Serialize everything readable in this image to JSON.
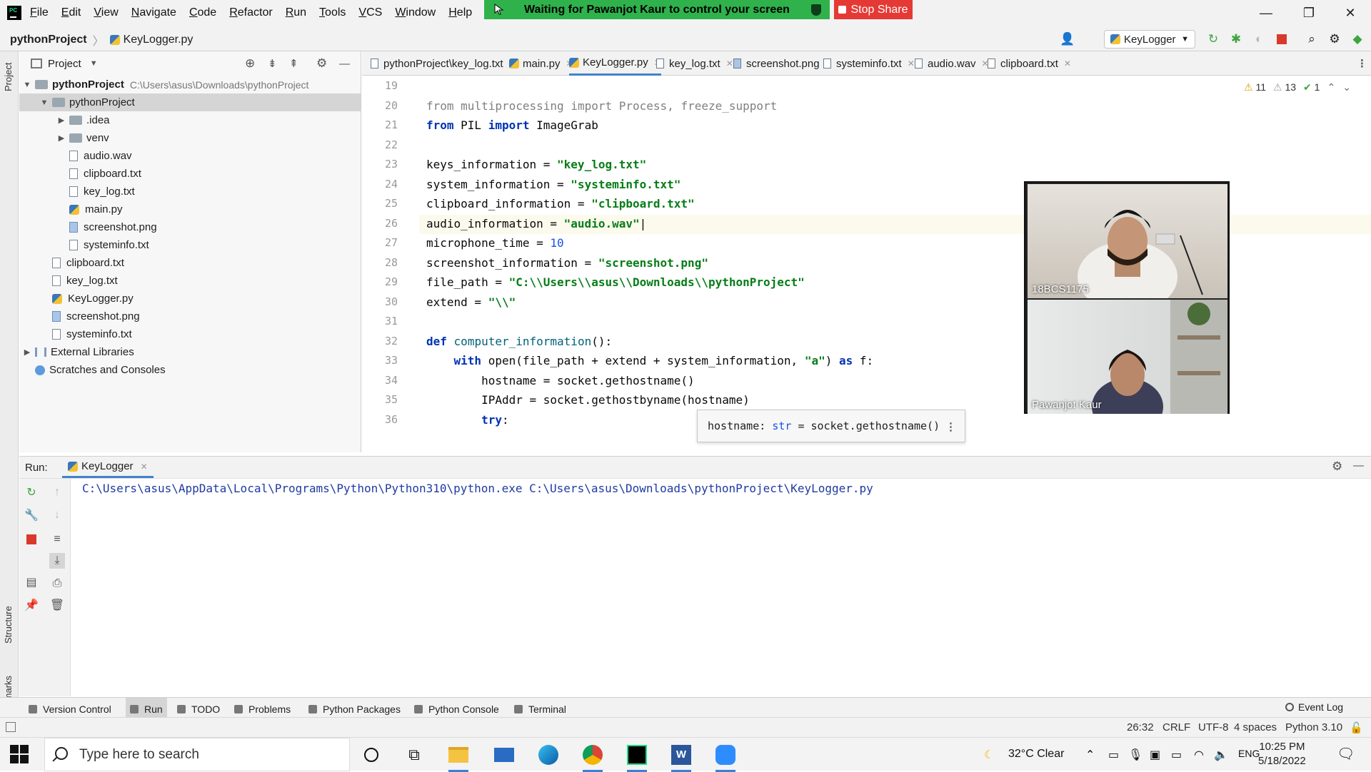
{
  "menubar": {
    "items": [
      {
        "label": "File",
        "u": "F",
        "rest": "ile"
      },
      {
        "label": "Edit",
        "u": "E",
        "rest": "dit"
      },
      {
        "label": "View",
        "u": "V",
        "rest": "iew"
      },
      {
        "label": "Navigate",
        "u": "N",
        "rest": "avigate"
      },
      {
        "label": "Code",
        "u": "C",
        "rest": "ode"
      },
      {
        "label": "Refactor",
        "u": "R",
        "rest": "efactor"
      },
      {
        "label": "Run",
        "u": "R",
        "rest": "un"
      },
      {
        "label": "Tools",
        "u": "T",
        "rest": "ools"
      },
      {
        "label": "VCS",
        "u": "V",
        "rest": "CS"
      },
      {
        "label": "Window",
        "u": "W",
        "rest": "indow"
      },
      {
        "label": "Help",
        "u": "H",
        "rest": "elp"
      }
    ],
    "project_title_partial": "pytho"
  },
  "share": {
    "banner_text": "Waiting for Pawanjot Kaur to control your screen",
    "stop_label": "Stop Share"
  },
  "window_controls": {
    "minimize": "—",
    "restore": "❐",
    "close": "✕"
  },
  "breadcrumb": {
    "project": "pythonProject",
    "file": "KeyLogger.py"
  },
  "toolbar": {
    "run_config": "KeyLogger"
  },
  "side_tabs": {
    "project": "Project",
    "structure": "Structure",
    "bookmarks": "Bookmarks"
  },
  "project_panel": {
    "title": "Project",
    "root_name": "pythonProject",
    "root_path": "C:\\Users\\asus\\Downloads\\pythonProject",
    "tree": [
      {
        "label": "pythonProject",
        "kind": "folder",
        "expanded": true,
        "selected": true,
        "depth": 1
      },
      {
        "label": ".idea",
        "kind": "folder",
        "expanded": false,
        "depth": 2
      },
      {
        "label": "venv",
        "kind": "folder",
        "expanded": false,
        "depth": 2
      },
      {
        "label": "audio.wav",
        "kind": "file",
        "depth": 2
      },
      {
        "label": "clipboard.txt",
        "kind": "file",
        "depth": 2
      },
      {
        "label": "key_log.txt",
        "kind": "file",
        "depth": 2
      },
      {
        "label": "main.py",
        "kind": "py",
        "depth": 2
      },
      {
        "label": "screenshot.png",
        "kind": "png",
        "depth": 2
      },
      {
        "label": "systeminfo.txt",
        "kind": "file",
        "depth": 2
      },
      {
        "label": "clipboard.txt",
        "kind": "file",
        "depth": 1
      },
      {
        "label": "key_log.txt",
        "kind": "file",
        "depth": 1
      },
      {
        "label": "KeyLogger.py",
        "kind": "py",
        "depth": 1
      },
      {
        "label": "screenshot.png",
        "kind": "png",
        "depth": 1
      },
      {
        "label": "systeminfo.txt",
        "kind": "file",
        "depth": 1
      }
    ],
    "external_libraries": "External Libraries",
    "scratches": "Scratches and Consoles"
  },
  "editor_tabs": [
    {
      "label": "pythonProject\\key_log.txt",
      "kind": "file"
    },
    {
      "label": "main.py",
      "kind": "py"
    },
    {
      "label": "KeyLogger.py",
      "kind": "py",
      "active": true
    },
    {
      "label": "key_log.txt",
      "kind": "file"
    },
    {
      "label": "screenshot.png",
      "kind": "png"
    },
    {
      "label": "systeminfo.txt",
      "kind": "file"
    },
    {
      "label": "audio.wav",
      "kind": "file"
    },
    {
      "label": "clipboard.txt",
      "kind": "file"
    }
  ],
  "inspection": {
    "warnings": "11",
    "weak_warnings": "13",
    "ok": "1"
  },
  "code": {
    "current_line": 26,
    "lines": [
      {
        "n": "19",
        "html": ""
      },
      {
        "n": "20",
        "html": "<span class=\"g\">from</span> <span class=\"g\">multiprocessing</span> <span class=\"g\">import</span> <span class=\"g\">Process, freeze_support</span>"
      },
      {
        "n": "21",
        "html": "<span class=\"k\">from</span> PIL <span class=\"k\">import</span> ImageGrab"
      },
      {
        "n": "22",
        "html": ""
      },
      {
        "n": "23",
        "html": "keys_information = <span class=\"s\">\"key_log.txt\"</span>"
      },
      {
        "n": "24",
        "html": "system_information = <span class=\"s\">\"systeminfo.txt\"</span>"
      },
      {
        "n": "25",
        "html": "clipboard_information = <span class=\"s\">\"clipboard.txt\"</span>"
      },
      {
        "n": "26",
        "html": "audio_information = <span class=\"s\">\"audio.wav\"</span>|"
      },
      {
        "n": "27",
        "html": "microphone_time = <span class=\"n\">10</span>"
      },
      {
        "n": "28",
        "html": "screenshot_information = <span class=\"s\">\"screenshot.png\"</span>"
      },
      {
        "n": "29",
        "html": "file_path = <span class=\"s\">\"C:\\\\Users\\\\asus\\\\Downloads\\\\pythonProject\"</span>"
      },
      {
        "n": "30",
        "html": "extend = <span class=\"s\">\"\\\\\"</span>"
      },
      {
        "n": "31",
        "html": ""
      },
      {
        "n": "32",
        "html": "<span class=\"k\">def</span> <span class=\"fn\">computer_information</span>():"
      },
      {
        "n": "33",
        "html": "    <span class=\"k\">with</span> open(file_path + extend + system_information, <span class=\"s\">\"a\"</span>) <span class=\"k\">as</span> f:"
      },
      {
        "n": "34",
        "html": "        hostname = socket.gethostname()"
      },
      {
        "n": "35",
        "html": "        IPAddr = socket.gethostbyname(hostname)"
      },
      {
        "n": "36",
        "html": "        <span class=\"k\">try</span>:"
      }
    ]
  },
  "hint": {
    "name": "hostname",
    "type": "str",
    "value": "= socket.gethostname()"
  },
  "video": {
    "participant1": "18BCS1175",
    "participant2": "Pawanjot Kaur"
  },
  "run_panel": {
    "title": "Run:",
    "tab": "KeyLogger",
    "console": "C:\\Users\\asus\\AppData\\Local\\Programs\\Python\\Python310\\python.exe C:\\Users\\asus\\Downloads\\pythonProject\\KeyLogger.py"
  },
  "tool_windows": [
    {
      "label": "Version Control"
    },
    {
      "label": "Run",
      "active": true
    },
    {
      "label": "TODO"
    },
    {
      "label": "Problems"
    },
    {
      "label": "Python Packages"
    },
    {
      "label": "Python Console"
    },
    {
      "label": "Terminal"
    }
  ],
  "event_log": "Event Log",
  "status": {
    "position": "26:32",
    "line_sep": "CRLF",
    "encoding": "UTF-8",
    "indent": "4 spaces",
    "interpreter": "Python 3.10"
  },
  "taskbar": {
    "search_placeholder": "Type here to search",
    "weather": "32°C  Clear",
    "lang": "ENG",
    "time": "10:25 PM",
    "date": "5/18/2022"
  }
}
